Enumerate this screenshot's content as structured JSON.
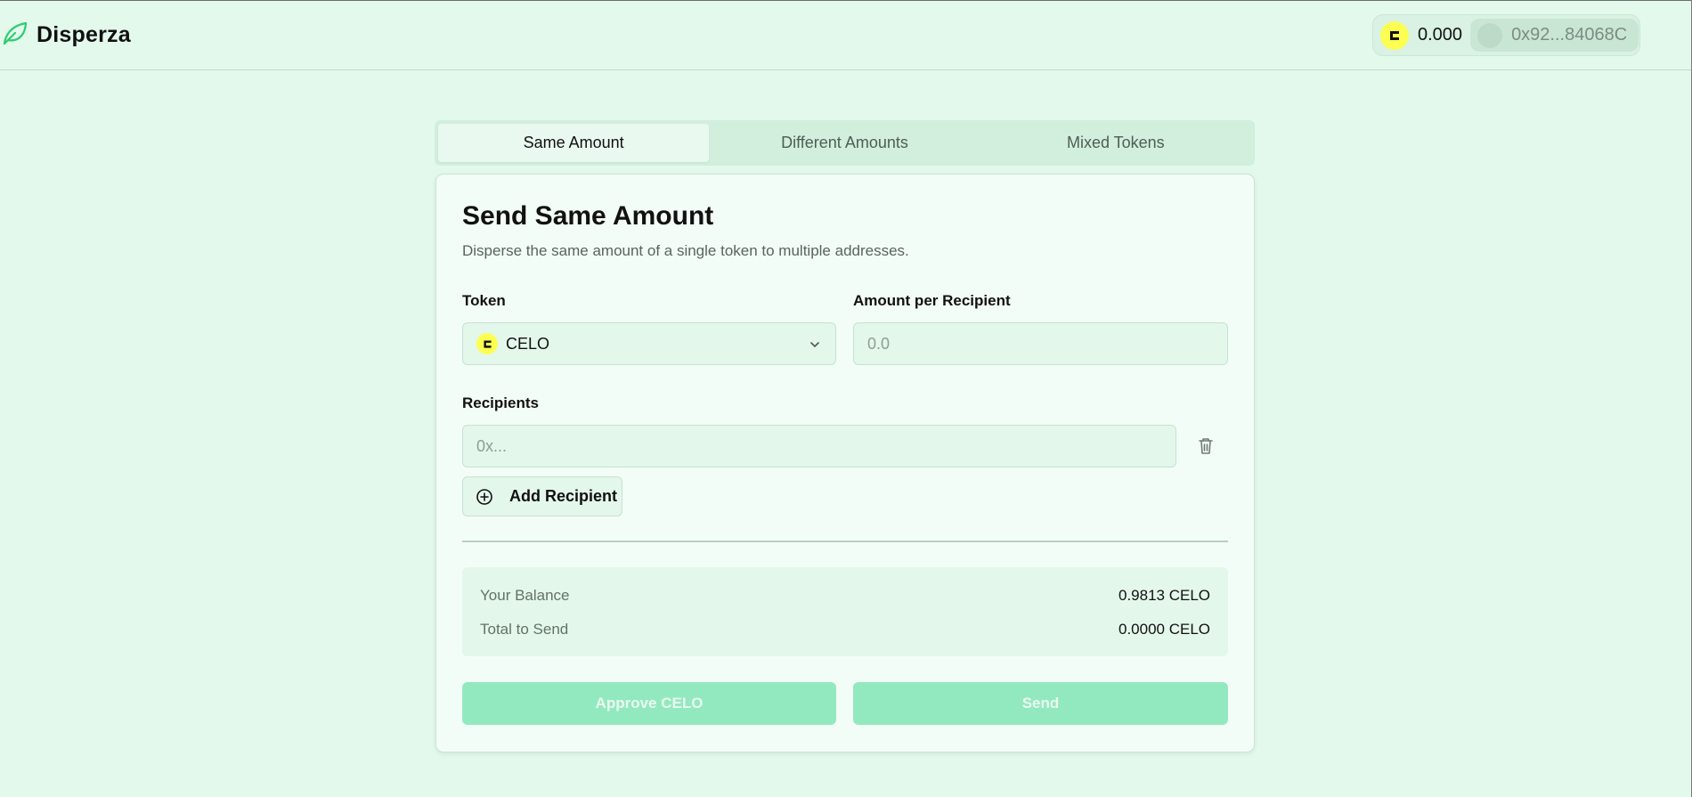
{
  "header": {
    "brand": "Disperza",
    "wallet": {
      "balance": "0.000",
      "address": "0x92...84068C"
    }
  },
  "tabs": [
    {
      "label": "Same Amount",
      "active": true
    },
    {
      "label": "Different Amounts",
      "active": false
    },
    {
      "label": "Mixed Tokens",
      "active": false
    }
  ],
  "card": {
    "title": "Send Same Amount",
    "subtitle": "Disperse the same amount of a single token to multiple addresses.",
    "token_label": "Token",
    "token_value": "CELO",
    "amount_label": "Amount per Recipient",
    "amount_placeholder": "0.0",
    "recipients_label": "Recipients",
    "recipient_placeholder": "0x...",
    "add_recipient_label": "Add Recipient",
    "summary": {
      "balance_label": "Your Balance",
      "balance_value": "0.9813 CELO",
      "total_label": "Total to Send",
      "total_value": "0.0000 CELO"
    },
    "approve_label": "Approve CELO",
    "send_label": "Send"
  },
  "colors": {
    "background": "#e3f9ec",
    "accent": "#2ecc71",
    "celo_yellow": "#fcff52",
    "disabled_button": "#93e9bf"
  },
  "icons": [
    "leaf-icon",
    "celo-icon",
    "chevron-down-icon",
    "trash-icon",
    "plus-circle-icon"
  ]
}
